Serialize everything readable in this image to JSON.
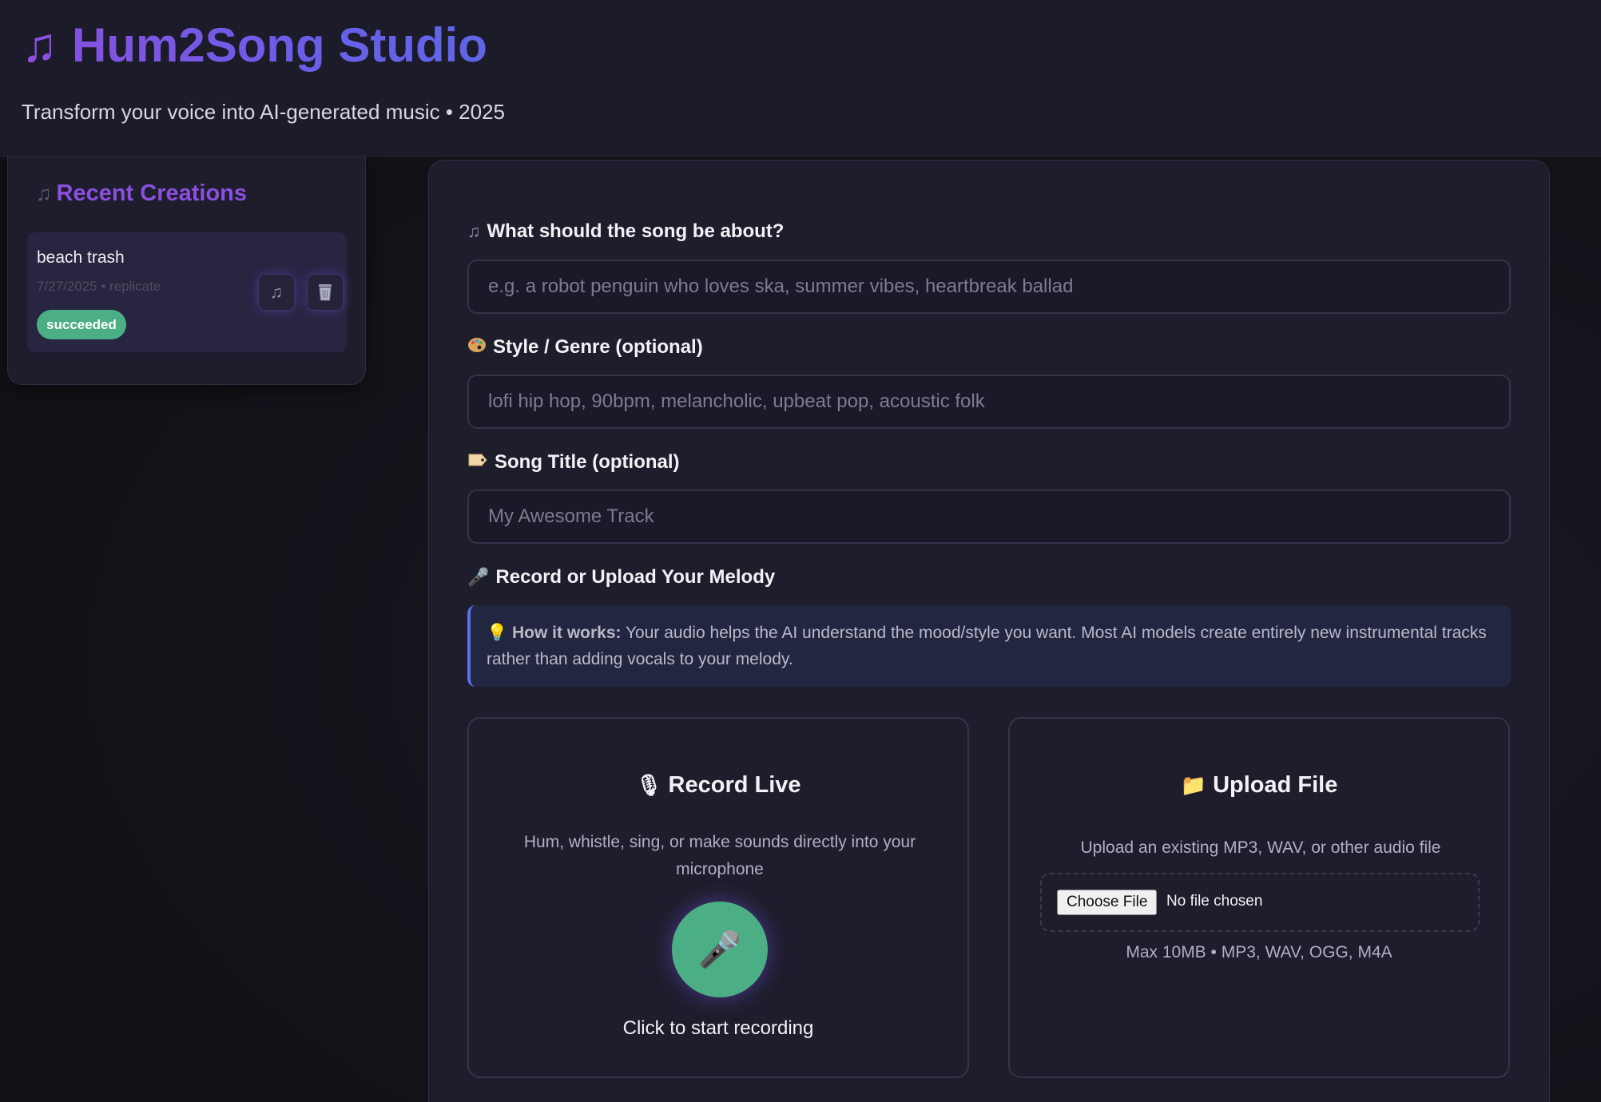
{
  "header": {
    "icon": "music-note-icon",
    "title": "Hum2Song Studio",
    "subtitle": "Transform your voice into AI-generated music • 2025"
  },
  "sidebar": {
    "title": "Recent Creations",
    "creations": [
      {
        "title": "beach trash",
        "meta": "7/27/2025 • replicate",
        "status": "succeeded"
      }
    ]
  },
  "form": {
    "about": {
      "label": "What should the song be about?",
      "placeholder": "e.g. a robot penguin who loves ska, summer vibes, heartbreak ballad",
      "value": ""
    },
    "style": {
      "label": "Style / Genre (optional)",
      "placeholder": "lofi hip hop, 90bpm, melancholic, upbeat pop, acoustic folk",
      "value": ""
    },
    "song_title": {
      "label": "Song Title (optional)",
      "placeholder": "My Awesome Track",
      "value": ""
    },
    "melody": {
      "label": "Record or Upload Your Melody",
      "info_bold": "How it works:",
      "info_text": " Your audio helps the AI understand the mood/style you want. Most AI models create entirely new instrumental tracks rather than adding vocals to your melody."
    }
  },
  "record": {
    "title": "Record Live",
    "description": "Hum, whistle, sing, or make sounds directly into your microphone",
    "caption": "Click to start recording"
  },
  "upload": {
    "title": "Upload File",
    "description": "Upload an existing MP3, WAV, or other audio file",
    "choose_label": "Choose File",
    "no_file": "No file chosen",
    "hint": "Max 10MB • MP3, WAV, OGG, M4A"
  },
  "colors": {
    "accent": "#8b4fe0",
    "success": "#4cae85",
    "info_border": "#5a6fe6"
  }
}
